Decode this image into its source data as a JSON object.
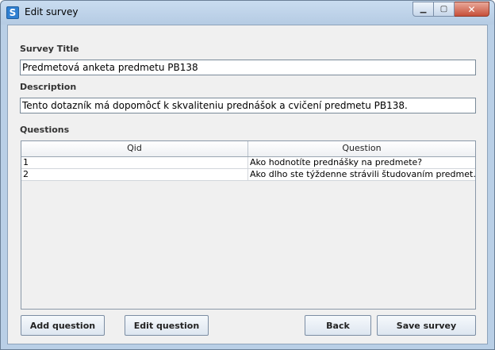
{
  "window": {
    "title": "Edit survey",
    "app_icon_letter": "S",
    "minimize_glyph": "▁",
    "maximize_glyph": "▢",
    "close_glyph": "✕"
  },
  "form": {
    "survey_title_label": "Survey Title",
    "survey_title_value": "Predmetová anketa predmetu PB138",
    "description_label": "Description",
    "description_value": "Tento dotazník má dopomôcť k skvaliteniu prednášok a cvičení predmetu PB138.",
    "questions_label": "Questions"
  },
  "table": {
    "columns": [
      "Qid",
      "Question"
    ],
    "rows": [
      {
        "qid": "1",
        "question": "Ako hodnotíte prednášky na predmete?"
      },
      {
        "qid": "2",
        "question": "Ako dlho ste týždenne strávili študovaním predmet..."
      }
    ]
  },
  "buttons": {
    "add_question": "Add question",
    "edit_question": "Edit question",
    "back": "Back",
    "save_survey": "Save survey"
  }
}
